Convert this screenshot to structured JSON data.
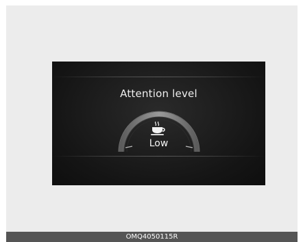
{
  "display": {
    "title": "Attention level",
    "level_label": "Low",
    "gauge_level": 0.0
  },
  "icons": {
    "center": "coffee-cup-icon"
  },
  "caption": "OMQ4050115R",
  "colors": {
    "screen": "#151515",
    "text": "#f0f0f0",
    "caption_bar": "#555555",
    "frame": "#ececec"
  }
}
